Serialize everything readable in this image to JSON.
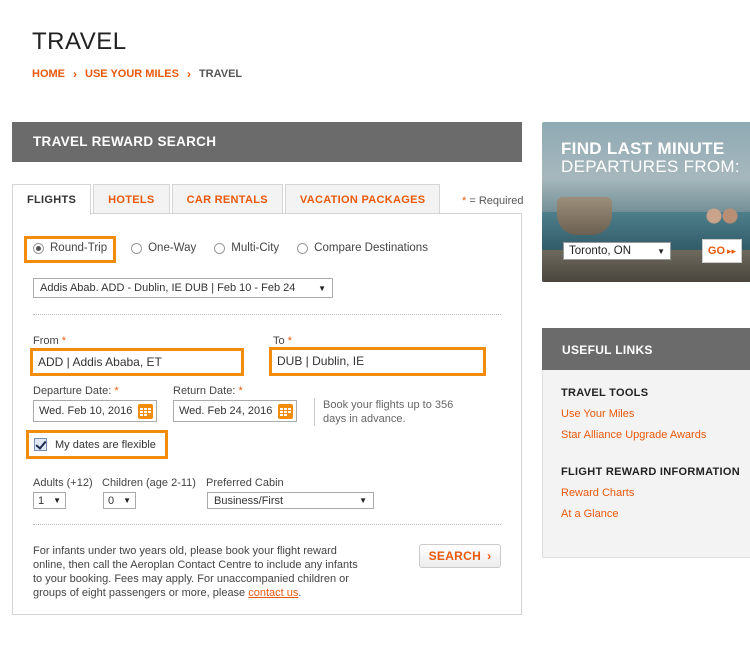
{
  "page": {
    "title": "TRAVEL",
    "breadcrumb": [
      "HOME",
      "USE YOUR MILES",
      "TRAVEL"
    ]
  },
  "search": {
    "header": "TRAVEL REWARD SEARCH",
    "tabs": [
      "FLIGHTS",
      "HOTELS",
      "CAR RENTALS",
      "VACATION PACKAGES"
    ],
    "active_tab": "FLIGHTS",
    "required_note": "= Required",
    "trip_types": [
      "Round-Trip",
      "One-Way",
      "Multi-City",
      "Compare Destinations"
    ],
    "selected_trip": "Round-Trip",
    "recent_search": "Addis Abab. ADD - Dublin, IE DUB | Feb 10 - Feb 24",
    "from_label": "From",
    "from_value": "ADD |  Addis Ababa, ET",
    "to_label": "To",
    "to_value": "DUB |  Dublin, IE",
    "departure_label": "Departure Date:",
    "departure_value": "Wed. Feb 10, 2016",
    "return_label": "Return Date:",
    "return_value": "Wed. Feb 24, 2016",
    "book_note": "Book your flights up to 356 days in advance.",
    "flexible_label": "My dates are flexible",
    "flexible_checked": true,
    "adults_label": "Adults (+12)",
    "adults_value": "1",
    "children_label": "Children (age 2-11)",
    "children_value": "0",
    "cabin_label": "Preferred Cabin",
    "cabin_value": "Business/First",
    "infant_note": "For infants under two years old, please book your flight reward online, then call the Aeroplan Contact Centre to include any infants to your booking. Fees may apply. For unaccompanied children or groups of eight passengers or more, please",
    "contact_link": "contact us",
    "contact_suffix": ".",
    "search_button": "SEARCH"
  },
  "promo": {
    "title": "FIND LAST MINUTE",
    "subtitle": "DEPARTURES FROM:",
    "city": "Toronto, ON",
    "go_button": "GO"
  },
  "links": {
    "header": "USEFUL LINKS",
    "sections": [
      {
        "title": "TRAVEL TOOLS",
        "items": [
          "Use Your Miles",
          "Star Alliance Upgrade Awards"
        ]
      },
      {
        "title": "FLIGHT REWARD INFORMATION",
        "items": [
          "Reward Charts",
          "At a Glance"
        ]
      }
    ]
  },
  "colors": {
    "accent": "#e8590c",
    "highlight": "#f28c0c",
    "header_bg": "#6b6b6b"
  }
}
